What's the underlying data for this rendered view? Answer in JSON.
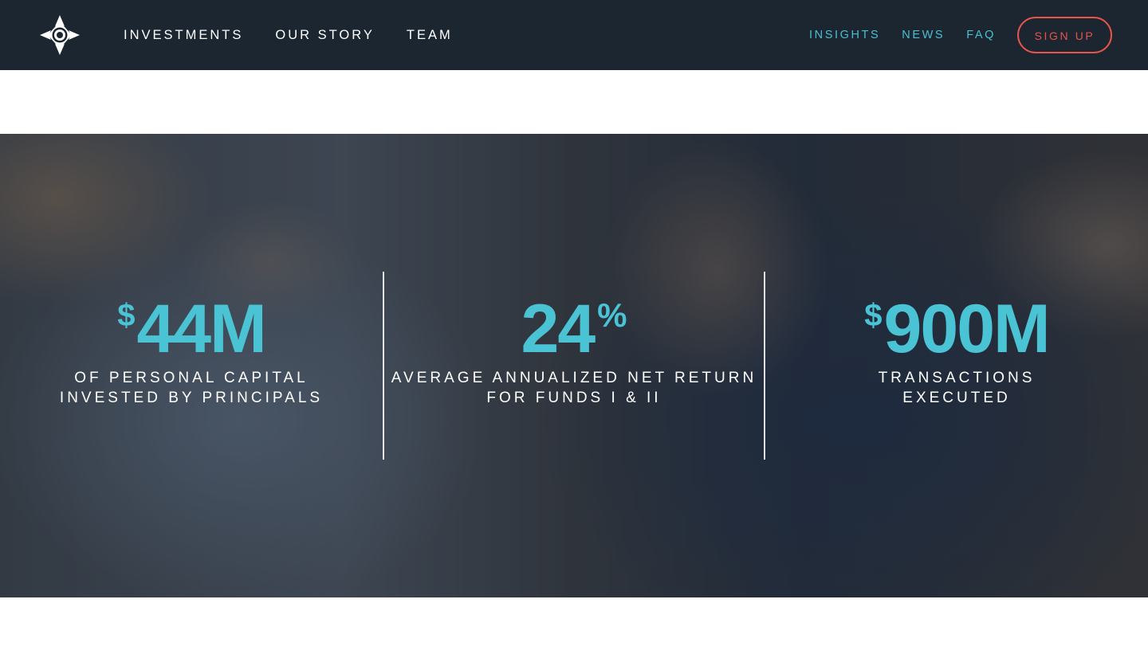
{
  "nav": {
    "left_links": [
      "INVESTMENTS",
      "OUR STORY",
      "TEAM"
    ],
    "right_links": [
      "INSIGHTS",
      "NEWS",
      "FAQ"
    ],
    "signup_label": "SIGN UP",
    "logo_icon": "compass-star-icon"
  },
  "hero": {
    "stats": [
      {
        "prefix": "$",
        "value": "44M",
        "suffix": "",
        "caption_line1": "OF PERSONAL CAPITAL",
        "caption_line2": "INVESTED BY PRINCIPALS"
      },
      {
        "prefix": "",
        "value": "24",
        "suffix": "%",
        "caption_line1": "AVERAGE ANNUALIZED NET RETURN",
        "caption_line2": "FOR FUNDS I & II"
      },
      {
        "prefix": "$",
        "value": "900M",
        "suffix": "",
        "caption_line1": "TRANSACTIONS",
        "caption_line2": "EXECUTED"
      }
    ]
  },
  "colors": {
    "nav_bg": "#1b2631",
    "accent": "#4ac3d5",
    "signup": "#e8534a"
  }
}
